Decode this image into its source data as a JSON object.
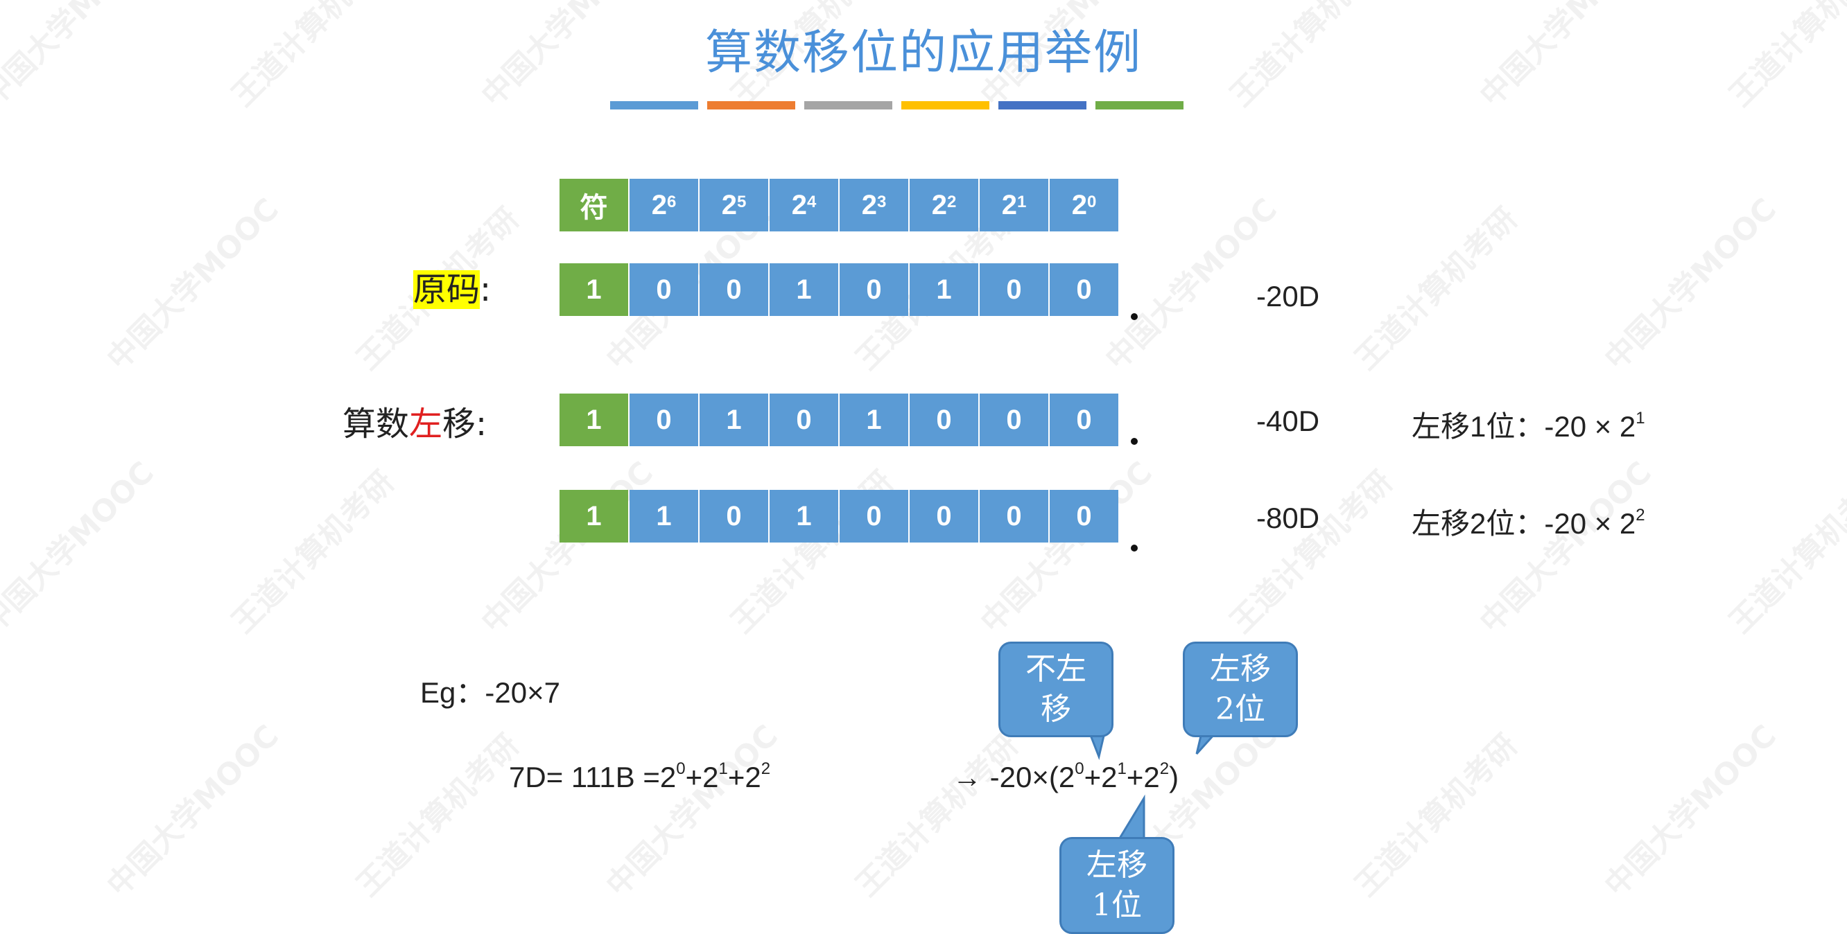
{
  "title": "算数移位的应用举例",
  "deco_colors": [
    "#5b9bd5",
    "#ed7d31",
    "#a5a5a5",
    "#ffc000",
    "#4472c4",
    "#70ad47"
  ],
  "watermark": {
    "text1": "中国大学MOOC",
    "text2": "王道计算机考研"
  },
  "header_row": {
    "sign": "符",
    "powers": [
      {
        "base": "2",
        "exp": "6"
      },
      {
        "base": "2",
        "exp": "5"
      },
      {
        "base": "2",
        "exp": "4"
      },
      {
        "base": "2",
        "exp": "3"
      },
      {
        "base": "2",
        "exp": "2"
      },
      {
        "base": "2",
        "exp": "1"
      },
      {
        "base": "2",
        "exp": "0"
      }
    ]
  },
  "original": {
    "label": "原码",
    "colon": ":",
    "bits": [
      "1",
      "0",
      "0",
      "1",
      "0",
      "1",
      "0",
      "0"
    ],
    "value": "-20D"
  },
  "left_shift": {
    "label_prefix": "算数",
    "label_red": "左",
    "label_suffix": "移",
    "colon": ":",
    "rows": [
      {
        "bits": [
          "1",
          "0",
          "1",
          "0",
          "1",
          "0",
          "0",
          "0"
        ],
        "value": "-40D",
        "note_prefix": "左移1位：-20 ",
        "times": "×",
        "note_base": " 2",
        "note_exp": "1"
      },
      {
        "bits": [
          "1",
          "1",
          "0",
          "1",
          "0",
          "0",
          "0",
          "0"
        ],
        "value": "-80D",
        "note_prefix": "左移2位：-20 ",
        "times": "×",
        "note_base": " 2",
        "note_exp": "2"
      }
    ]
  },
  "example": {
    "eg_prefix": "Eg：-20",
    "eg_times": "×",
    "eg_suffix": "7",
    "bin_prefix": "7D= 111B =2",
    "bin_e0": "0",
    "bin_mid1": "+2",
    "bin_e1": "1",
    "bin_mid2": "+2",
    "bin_e2": "2",
    "arrow": "→",
    "res_prefix": " -20",
    "res_times": "×",
    "res_open": "(2",
    "res_e0": "0",
    "res_mid1": "+2",
    "res_e1": "1",
    "res_mid2": "+2",
    "res_e2": "2",
    "res_close": ")"
  },
  "callouts": {
    "no_shift": [
      "不左",
      "移"
    ],
    "shift2": [
      "左移",
      "2位"
    ],
    "shift1": [
      "左移",
      "1位"
    ]
  }
}
